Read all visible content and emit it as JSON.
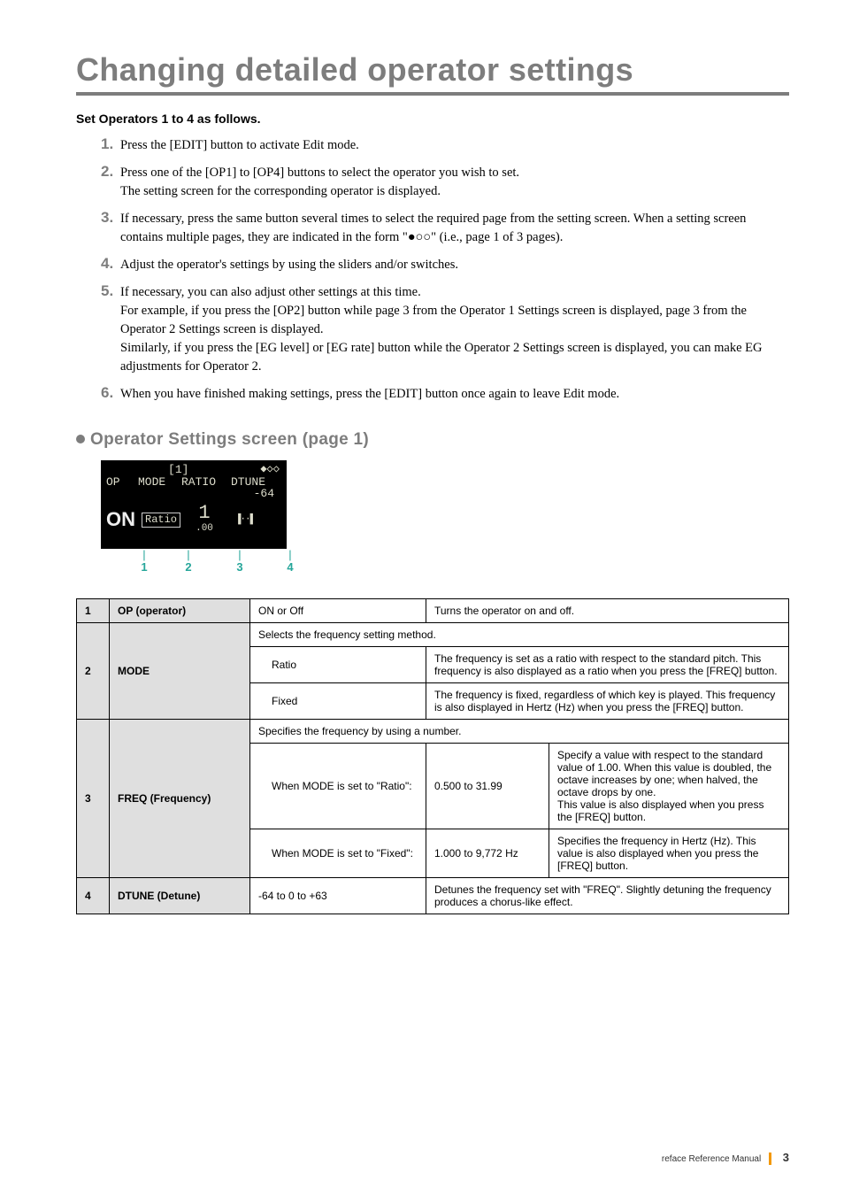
{
  "title": "Changing detailed operator settings",
  "intro": "Set Operators 1 to 4 as follows.",
  "steps": [
    "Press the [EDIT] button to activate Edit mode.",
    "Press one of the [OP1] to [OP4] buttons to select the operator you wish to set.\nThe setting screen for the corresponding operator is displayed.",
    "If necessary, press the same button several times to select the required page from the setting screen. When a setting screen contains multiple pages, they are indicated in the form \"●○○\" (i.e., page 1 of 3 pages).",
    "Adjust the operator's settings by using the sliders and/or switches.",
    "If necessary, you can also adjust other settings at this time.\nFor example, if you press the [OP2] button while page 3 from the Operator 1 Settings screen is displayed, page 3 from the Operator 2 Settings screen is displayed.\nSimilarly, if you press the [EG level] or [EG rate] button while the Operator 2 Settings screen is displayed, you can make EG adjustments for Operator 2.",
    "When you have finished making settings, press the [EDIT] button once again to leave Edit mode."
  ],
  "section1": "Operator Settings screen (page 1)",
  "lcd": {
    "op_index": "1",
    "page_indicator": "◆◇◇",
    "header_op": "OP",
    "header_mode": "MODE",
    "header_ratio": "RATIO",
    "header_dtune": "DTUNE",
    "on_label": "ON",
    "ratio_label": "Ratio",
    "freq_big": "1",
    "freq_small": ".00",
    "dtune_val": "-64",
    "dtune_marker": "▐··▌"
  },
  "markers": [
    "1",
    "2",
    "3",
    "4"
  ],
  "table": {
    "r1": {
      "num": "1",
      "name": "OP (operator)",
      "val": "ON or Off",
      "desc": "Turns the operator on and off."
    },
    "r2": {
      "num": "2",
      "name": "MODE",
      "head": "Selects the frequency setting method.",
      "ratio_label": "Ratio",
      "ratio_desc": "The frequency is set as a ratio with respect to the standard pitch. This frequency is also displayed as a ratio when you press the [FREQ] button.",
      "fixed_label": "Fixed",
      "fixed_desc": "The frequency is fixed, regardless of which key is played. This frequency is also displayed in Hertz (Hz) when you press the [FREQ] button."
    },
    "r3": {
      "num": "3",
      "name": "FREQ (Frequency)",
      "head": "Specifies the frequency by using a number.",
      "ratio_cond": "When MODE is set to \"Ratio\":",
      "ratio_range": "0.500 to 31.99",
      "ratio_desc": "Specify a value with respect to the standard value of 1.00. When this value is doubled, the octave increases by one; when halved, the octave drops by one.\nThis value is also displayed when you press the [FREQ] button.",
      "fixed_cond": "When MODE is set to \"Fixed\":",
      "fixed_range": "1.000 to 9,772 Hz",
      "fixed_desc": "Specifies the frequency in Hertz (Hz). This value is also displayed when you press the [FREQ] button."
    },
    "r4": {
      "num": "4",
      "name": "DTUNE (Detune)",
      "val": "-64 to 0 to +63",
      "desc": "Detunes the frequency set with \"FREQ\". Slightly detuning the frequency produces a chorus-like effect."
    }
  },
  "footer": {
    "manual": "reface Reference Manual",
    "page": "3"
  }
}
